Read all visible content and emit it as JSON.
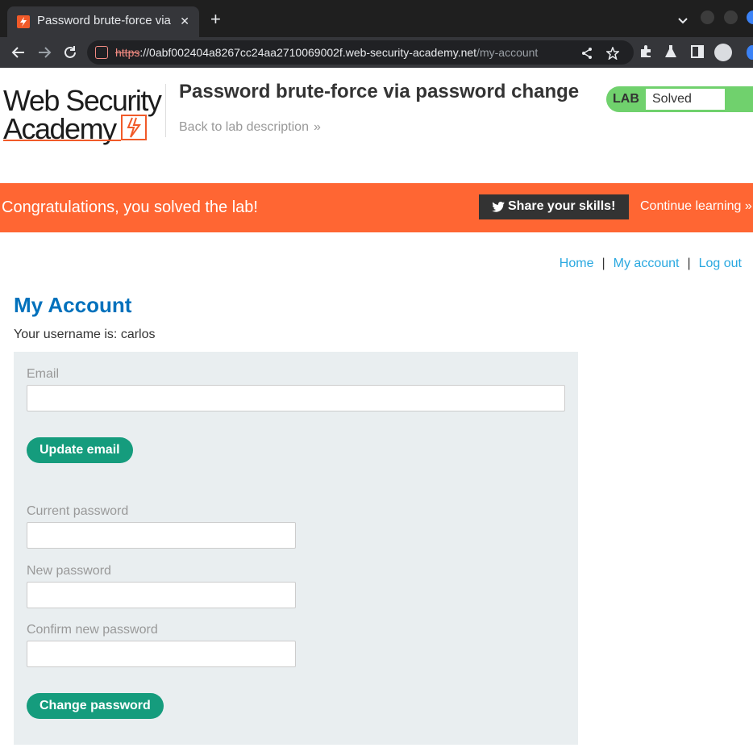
{
  "browser": {
    "tab_title": "Password brute-force via p",
    "tab_close": "✕",
    "new_tab": "+",
    "url_scheme": "https",
    "url_host": "://0abf002404a8267cc24aa2710069002f.web-security-academy.net",
    "url_path": "/my-account"
  },
  "header": {
    "logo_line1": "Web Security",
    "logo_line2": "Academy",
    "lab_title": "Password brute-force via password change",
    "back_link": "Back to lab description",
    "back_chevron": "»",
    "lab_label": "LAB",
    "lab_status": "Solved"
  },
  "banner": {
    "message": "Congratulations, you solved the lab!",
    "share_label": "Share your skills!",
    "continue_label": "Continue learning »"
  },
  "nav": {
    "home": "Home",
    "my_account": "My account",
    "log_out": "Log out",
    "separator": "|"
  },
  "account": {
    "heading": "My Account",
    "username_line": "Your username is: carlos",
    "email_label": "Email",
    "email_value": "",
    "update_email_button": "Update email",
    "current_password_label": "Current password",
    "new_password_label": "New password",
    "confirm_password_label": "Confirm new password",
    "change_password_button": "Change password"
  },
  "colors": {
    "banner": "#ff6633",
    "solved": "#70d16d",
    "button": "#159c7d",
    "link": "#29a8e0",
    "heading": "#0071bc"
  }
}
